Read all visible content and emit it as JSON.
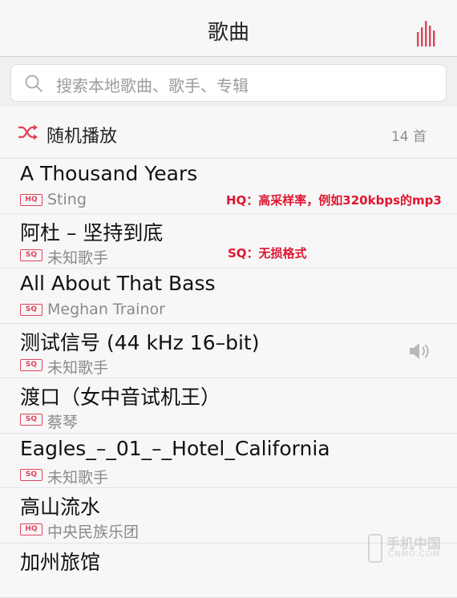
{
  "header": {
    "title": "歌曲",
    "equalizer_icon": "equalizer-icon"
  },
  "search": {
    "placeholder": "搜索本地歌曲、歌手、专辑",
    "icon": "search-icon"
  },
  "shuffle": {
    "label": "随机播放",
    "count": "14 首",
    "icon": "shuffle-icon"
  },
  "songs": [
    {
      "title": "A Thousand Years",
      "quality": "HQ",
      "artist": "Sting"
    },
    {
      "title": "阿杜 – 坚持到底",
      "quality": "SQ",
      "artist": "未知歌手"
    },
    {
      "title": "All About That Bass",
      "quality": "SQ",
      "artist": "Meghan Trainor"
    },
    {
      "title": "测试信号 (44 kHz 16–bit)",
      "quality": "SQ",
      "artist": "未知歌手",
      "playing": true
    },
    {
      "title": "渡口（女中音试机王）",
      "quality": "SQ",
      "artist": "蔡琴"
    },
    {
      "title": "Eagles_–_01_–_Hotel_California",
      "quality": "SQ",
      "artist": "未知歌手"
    },
    {
      "title": "高山流水",
      "quality": "HQ",
      "artist": "中央民族乐团"
    },
    {
      "title": "加州旅馆",
      "quality": "",
      "artist": ""
    }
  ],
  "annotations": {
    "hq": "HQ：高采样率，例如320kbps的mp3",
    "sq": "SQ：无损格式"
  },
  "watermark": {
    "line1": "手机中国",
    "line2": "CNMO.COM"
  },
  "colors": {
    "accent": "#e2425a",
    "annotation": "#e0152f"
  }
}
